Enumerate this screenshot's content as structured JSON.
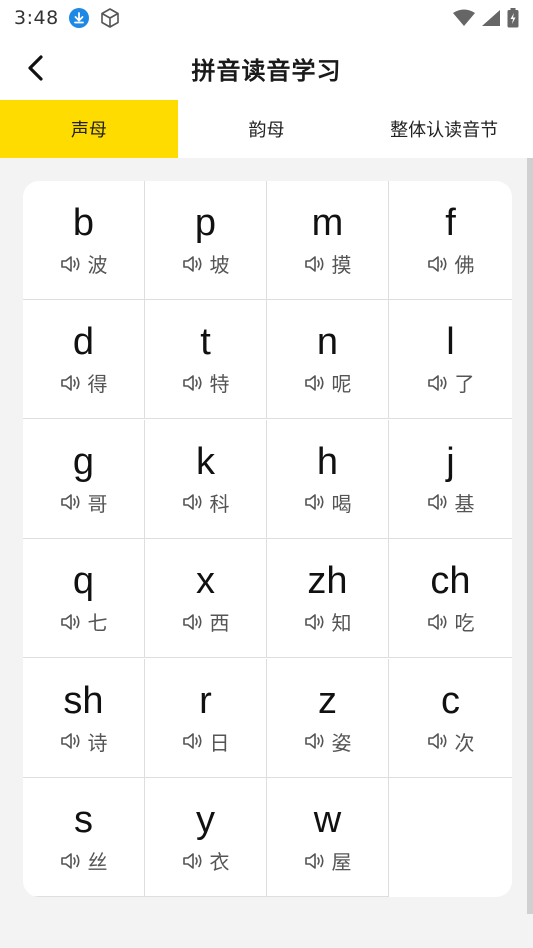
{
  "status_bar": {
    "time": "3:48",
    "icons": [
      "download-icon",
      "cube-icon",
      "wifi-icon",
      "signal-icon",
      "battery-icon"
    ]
  },
  "header": {
    "title": "拼音读音学习",
    "back_icon": "chevron-left-icon"
  },
  "tabs": [
    {
      "label": "声母",
      "active": true
    },
    {
      "label": "韵母",
      "active": false
    },
    {
      "label": "整体认读音节",
      "active": false
    }
  ],
  "colors": {
    "accent": "#ffdc00",
    "background": "#f3f3f3"
  },
  "items": [
    {
      "letter": "b",
      "char": "波"
    },
    {
      "letter": "p",
      "char": "坡"
    },
    {
      "letter": "m",
      "char": "摸"
    },
    {
      "letter": "f",
      "char": "佛"
    },
    {
      "letter": "d",
      "char": "得"
    },
    {
      "letter": "t",
      "char": "特"
    },
    {
      "letter": "n",
      "char": "呢"
    },
    {
      "letter": "l",
      "char": "了"
    },
    {
      "letter": "g",
      "char": "哥"
    },
    {
      "letter": "k",
      "char": "科"
    },
    {
      "letter": "h",
      "char": "喝"
    },
    {
      "letter": "j",
      "char": "基"
    },
    {
      "letter": "q",
      "char": "七"
    },
    {
      "letter": "x",
      "char": "西"
    },
    {
      "letter": "zh",
      "char": "知"
    },
    {
      "letter": "ch",
      "char": "吃"
    },
    {
      "letter": "sh",
      "char": "诗"
    },
    {
      "letter": "r",
      "char": "日"
    },
    {
      "letter": "z",
      "char": "姿"
    },
    {
      "letter": "c",
      "char": "次"
    },
    {
      "letter": "s",
      "char": "丝"
    },
    {
      "letter": "y",
      "char": "衣"
    },
    {
      "letter": "w",
      "char": "屋"
    }
  ]
}
